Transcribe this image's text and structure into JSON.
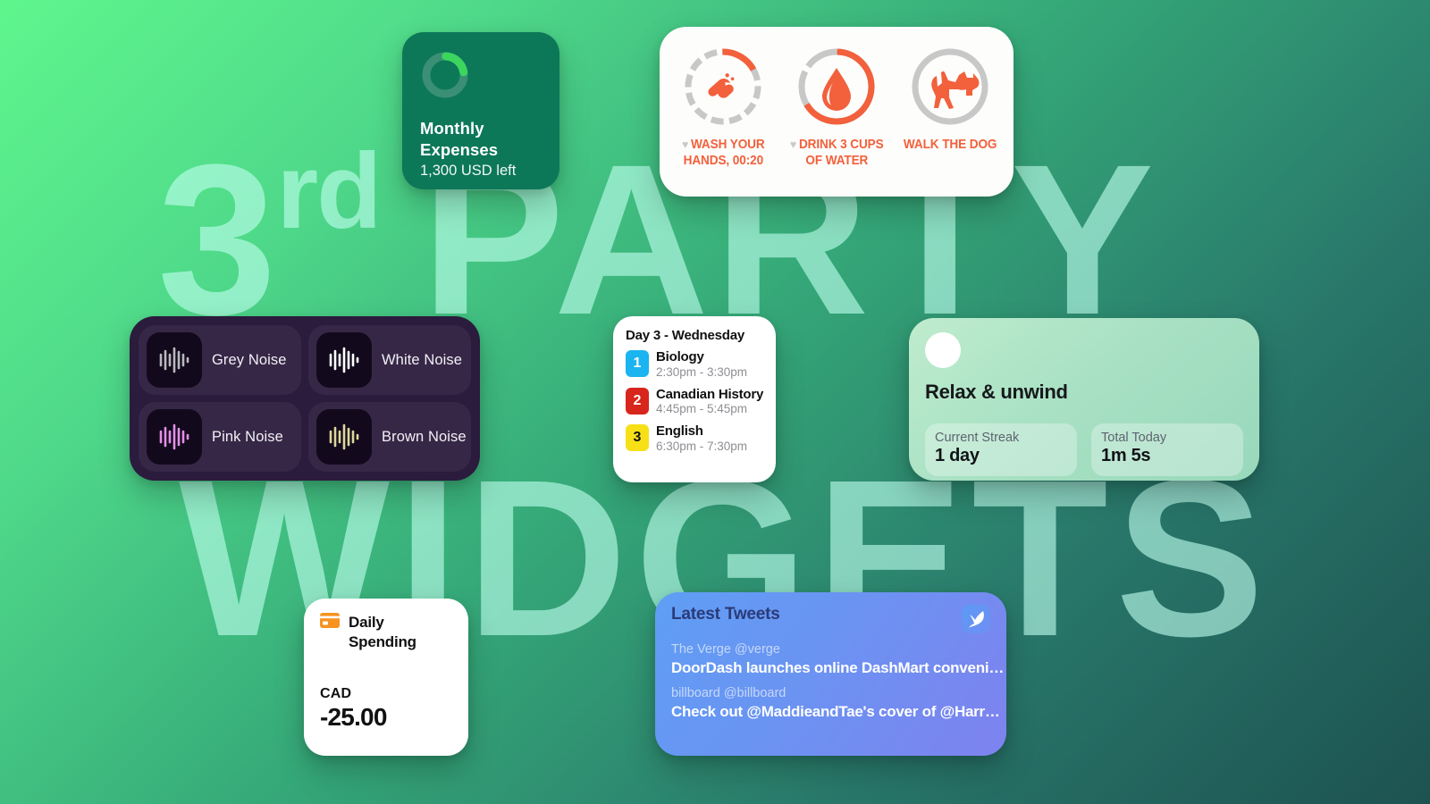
{
  "background": {
    "line1_number": "3",
    "line1_ordinal": "rd",
    "line1_word": "PARTY",
    "line2_word": "WIDGETS",
    "gradient_from": "#5ff68d",
    "gradient_to": "#1d5250",
    "text_color": "#beffee"
  },
  "expenses_widget": {
    "title": "Monthly\nExpenses",
    "title_line1": "Monthly",
    "title_line2": "Expenses",
    "subtitle": "1,300 USD left",
    "card_color": "#0c7858",
    "ring_progress_color": "#3cd65f",
    "ring_track_color": "#3a8f75",
    "ring_progress_percent": 22
  },
  "habits_widget": {
    "card_color": "#fdfdfb",
    "accent_color": "#f2603c",
    "track_color": "#c8c8c8",
    "items": [
      {
        "icon": "washing-hands-icon",
        "label": "WASH YOUR HANDS, 00:20",
        "progress_percent": 18,
        "segmented": true,
        "favorite": true
      },
      {
        "icon": "water-drop-icon",
        "label": "DRINK 3 CUPS OF WATER",
        "progress_percent": 66,
        "segmented": true,
        "favorite": true
      },
      {
        "icon": "dog-icon",
        "label": "WALK THE DOG",
        "progress_percent": 0,
        "segmented": false,
        "favorite": false
      }
    ]
  },
  "noise_widget": {
    "card_color": "#2b1b3d",
    "items": [
      {
        "label": "Grey Noise",
        "wave_color": "#b9b9bd"
      },
      {
        "label": "White Noise",
        "wave_color": "#ffffff"
      },
      {
        "label": "Pink Noise",
        "wave_color": "#e48fe8"
      },
      {
        "label": "Brown Noise",
        "wave_color": "#ded79a"
      }
    ]
  },
  "schedule_widget": {
    "title": "Day 3 - Wednesday",
    "rows": [
      {
        "number": "1",
        "name": "Biology",
        "time": "2:30pm - 3:30pm",
        "color": "#1ab4f0"
      },
      {
        "number": "2",
        "name": "Canadian History",
        "time": "4:45pm - 5:45pm",
        "color": "#d8261c"
      },
      {
        "number": "3",
        "name": "English",
        "time": "6:30pm - 7:30pm",
        "color": "#f7e018"
      }
    ]
  },
  "relax_widget": {
    "title": "Relax & unwind",
    "stats": [
      {
        "label": "Current Streak",
        "value": "1 day"
      },
      {
        "label": "Total Today",
        "value": "1m 5s"
      }
    ]
  },
  "spending_widget": {
    "icon": "credit-card-icon",
    "title_line1": "Daily",
    "title_line2": "Spending",
    "currency": "CAD",
    "amount": "-25.00",
    "icon_color": "#f7931e"
  },
  "tweets_widget": {
    "title": "Latest Tweets",
    "icon": "twitter-bird-icon",
    "items": [
      {
        "author": "The Verge @verge",
        "text": "DoorDash launches online DashMart conveni…"
      },
      {
        "author": "billboard @billboard",
        "text": "Check out @MaddieandTae's cover of @Harr…"
      }
    ]
  }
}
